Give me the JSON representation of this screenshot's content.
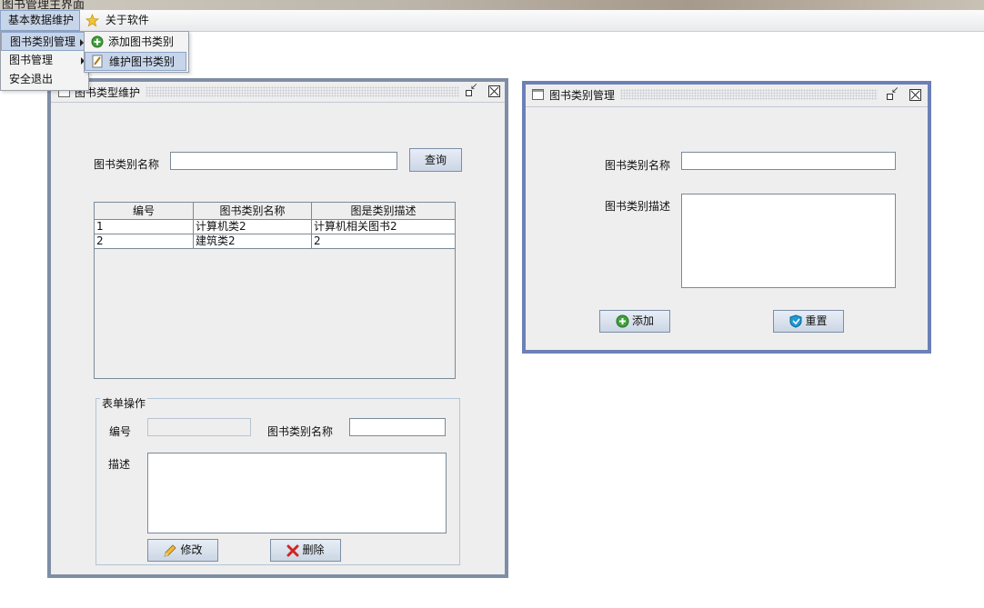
{
  "window": {
    "title": "图书管理主界面"
  },
  "menubar": {
    "items": [
      {
        "label": "基本数据维护"
      },
      {
        "label": "关于软件"
      }
    ]
  },
  "dropdown": {
    "items": [
      {
        "label": "图书类别管理"
      },
      {
        "label": "图书管理"
      },
      {
        "label": "安全退出"
      }
    ],
    "submenu": [
      {
        "label": "添加图书类别"
      },
      {
        "label": "维护图书类别"
      }
    ]
  },
  "maintain_frame": {
    "title": "图书类型维护",
    "search_label": "图书类别名称",
    "search_value": "",
    "query_button": "查询",
    "table": {
      "columns": [
        "编号",
        "图书类别名称",
        "图是类别描述"
      ],
      "rows": [
        [
          "1",
          "计算机类2",
          "计算机相关图书2"
        ],
        [
          "2",
          "建筑类2",
          "2"
        ]
      ]
    },
    "form": {
      "title": "表单操作",
      "id_label": "编号",
      "id_value": "",
      "name_label": "图书类别名称",
      "name_value": "",
      "desc_label": "描述",
      "desc_value": "",
      "edit_button": "修改",
      "delete_button": "删除"
    }
  },
  "add_frame": {
    "title": "图书类别管理",
    "name_label": "图书类别名称",
    "name_value": "",
    "desc_label": "图书类别描述",
    "desc_value": "",
    "add_button": "添加",
    "reset_button": "重置"
  },
  "colors": {
    "accent": "#6b80b7",
    "frame_border": "#7f8ea6",
    "selection": "#c7d5ea"
  }
}
